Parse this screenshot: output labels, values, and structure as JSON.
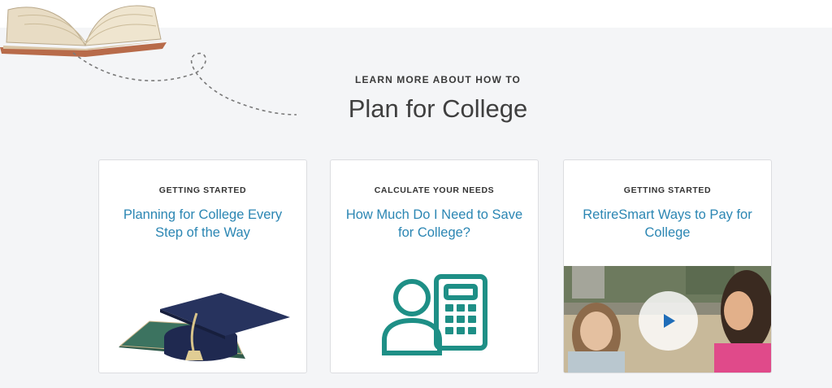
{
  "header": {
    "eyebrow": "LEARN MORE ABOUT HOW TO",
    "title": "Plan for College"
  },
  "cards": [
    {
      "kicker": "GETTING STARTED",
      "link": "Planning for College Every Step of the Way",
      "image_icon": "graduation-cap-and-diploma"
    },
    {
      "kicker": "CALCULATE YOUR NEEDS",
      "link": "How Much Do I Need to Save for College?",
      "image_icon": "person-calculator-icon"
    },
    {
      "kicker": "GETTING STARTED",
      "link": "RetireSmart Ways to Pay for College",
      "image_icon": "video-thumbnail-play"
    }
  ],
  "colors": {
    "background": "#f4f5f7",
    "link": "#2b86b3",
    "teal_icon": "#1e8f86"
  }
}
